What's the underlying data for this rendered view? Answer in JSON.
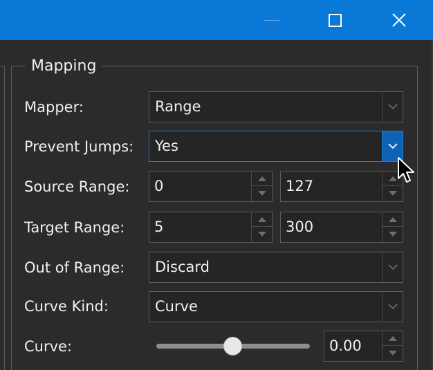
{
  "window": {
    "controls": [
      "minimize",
      "maximize",
      "close"
    ]
  },
  "mapping": {
    "title": "Mapping",
    "mapper": {
      "label": "Mapper:",
      "value": "Range"
    },
    "prevent_jumps": {
      "label": "Prevent Jumps:",
      "value": "Yes"
    },
    "source_range": {
      "label": "Source Range:",
      "min": "0",
      "max": "127"
    },
    "target_range": {
      "label": "Target Range:",
      "min": "5",
      "max": "300"
    },
    "out_of_range": {
      "label": "Out of Range:",
      "value": "Discard"
    },
    "curve_kind": {
      "label": "Curve Kind:",
      "value": "Curve"
    },
    "curve": {
      "label": "Curve:",
      "value": "0.00",
      "slider_fraction": 0.5
    }
  },
  "colors": {
    "titlebar": "#0a78d7",
    "background": "#2b2b2b",
    "focus": "#1b7fd6"
  }
}
